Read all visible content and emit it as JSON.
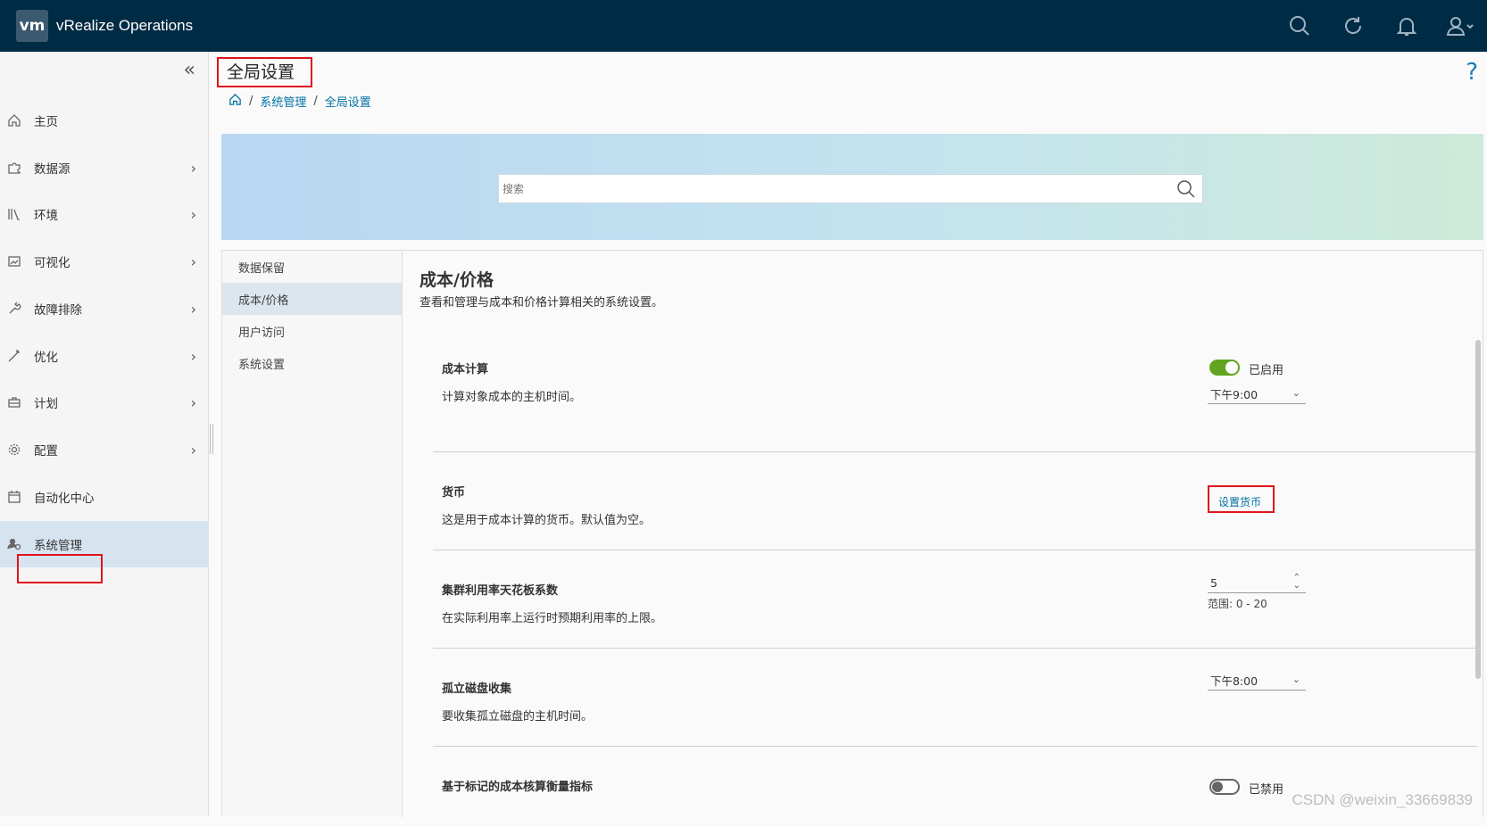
{
  "app": {
    "logo": "vm",
    "title": "vRealize Operations"
  },
  "topbar_icons": [
    "search-icon",
    "refresh-icon",
    "bell-icon",
    "user-icon"
  ],
  "sidebar": {
    "collapse": "«",
    "items": [
      {
        "label": "主页",
        "icon": "home-icon",
        "chevron": ""
      },
      {
        "label": "数据源",
        "icon": "puzzle-icon",
        "chevron": "›"
      },
      {
        "label": "环境",
        "icon": "library-icon",
        "chevron": "›"
      },
      {
        "label": "可视化",
        "icon": "image-icon",
        "chevron": "›"
      },
      {
        "label": "故障排除",
        "icon": "wrench-icon",
        "chevron": "›"
      },
      {
        "label": "优化",
        "icon": "wand-icon",
        "chevron": "›"
      },
      {
        "label": "计划",
        "icon": "briefcase-icon",
        "chevron": "›"
      },
      {
        "label": "配置",
        "icon": "gear-icon",
        "chevron": "›"
      },
      {
        "label": "自动化中心",
        "icon": "calendar-icon",
        "chevron": ""
      },
      {
        "label": "系统管理",
        "icon": "admin-icon",
        "chevron": ""
      }
    ],
    "active_index": 9
  },
  "page": {
    "title": "全局设置",
    "help": "?"
  },
  "breadcrumb": {
    "sep": "/",
    "items": [
      "系统管理",
      "全局设置"
    ]
  },
  "search": {
    "placeholder": "搜索"
  },
  "subnav": {
    "items": [
      "数据保留",
      "成本/价格",
      "用户访问",
      "系统设置"
    ],
    "active_index": 1
  },
  "content": {
    "title": "成本/价格",
    "desc": "查看和管理与成本和价格计算相关的系统设置。",
    "rows": {
      "cost_calc": {
        "title": "成本计算",
        "desc": "计算对象成本的主机时间。",
        "toggle_label": "已启用",
        "toggle_on": true,
        "time": "下午9:00"
      },
      "currency": {
        "title": "货币",
        "desc": "这是用于成本计算的货币。默认值为空。",
        "button": "设置货币"
      },
      "cluster": {
        "title": "集群利用率天花板系数",
        "desc": "在实际利用率上运行时预期利用率的上限。",
        "value": "5",
        "range": "范围: 0 - 20"
      },
      "orphan": {
        "title": "孤立磁盘收集",
        "desc": "要收集孤立磁盘的主机时间。",
        "time": "下午8:00"
      },
      "tag": {
        "title": "基于标记的成本核算衡量指标",
        "toggle_label": "已禁用",
        "toggle_on": false
      }
    }
  },
  "watermark": "CSDN @weixin_33669839",
  "colors": {
    "topbar": "#002b45",
    "accent": "#0072a3",
    "toggle_on": "#62a420",
    "highlight": "#e0141c"
  }
}
